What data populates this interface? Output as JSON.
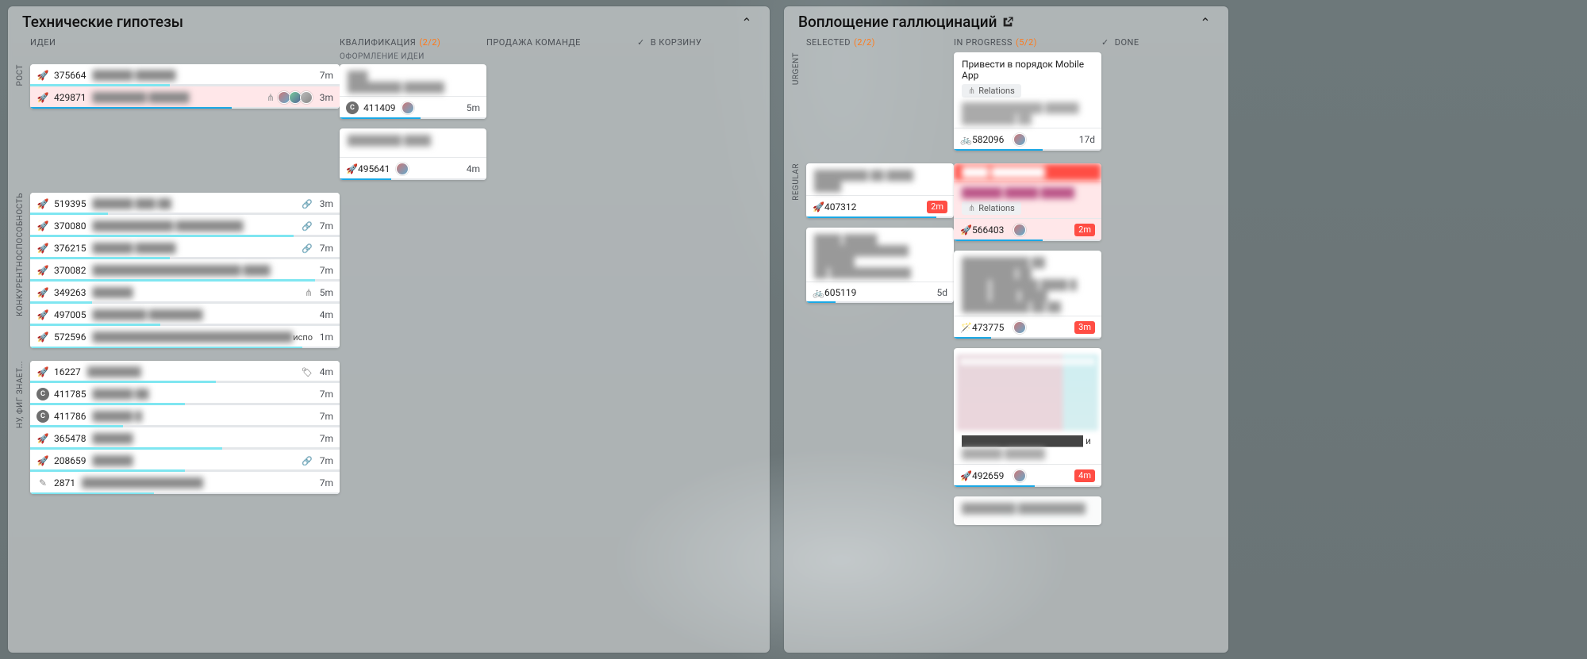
{
  "boards": {
    "left": {
      "title": "Технические гипотезы",
      "columns": {
        "c1": "ИДЕИ",
        "c2": "КВАЛИФИКАЦИЯ",
        "c2_ratio": "(2/2)",
        "c2_sub": "ОФОРМЛЕНИЕ ИДЕИ",
        "c3": "ПРОДАЖА КОМАНДЕ",
        "c4": "В КОРЗИНУ"
      },
      "lanes": {
        "rost": "РОСТ",
        "konk": "КОНКУРЕНТНОСПОСОБНОСТЬ",
        "nu": "НУ, ФИГ ЗНАЕТ..."
      },
      "rost_rows": [
        {
          "icon": "rocket",
          "id": "375664",
          "age": "7m",
          "pink": false,
          "progress": 45
        },
        {
          "icon": "rocket",
          "id": "429871",
          "age": "3m",
          "pink": true,
          "avatars": 3,
          "tree": true,
          "progress": 65
        }
      ],
      "rost_qual": [
        {
          "header_blur": true,
          "footer": {
            "id": "411409",
            "age": "5m",
            "avatar": true,
            "circle": "C"
          }
        },
        {
          "header_blur": true,
          "footer": {
            "id": "495641",
            "age": "4m",
            "avatar": true,
            "icon": "rocket"
          }
        }
      ],
      "konk_rows": [
        {
          "icon": "rocket",
          "id": "519395",
          "age": "3m",
          "link": true,
          "progress": 25
        },
        {
          "icon": "rocket",
          "id": "370080",
          "age": "7m",
          "link": true,
          "progress": 85
        },
        {
          "icon": "rocket",
          "id": "376215",
          "age": "7m",
          "link": true,
          "progress": 45
        },
        {
          "icon": "rocket",
          "id": "370082",
          "age": "7m",
          "progress": 92
        },
        {
          "icon": "rocket",
          "id": "349263",
          "age": "5m",
          "tree": true,
          "progress": 20
        },
        {
          "icon": "rocket",
          "id": "497005",
          "age": "4m",
          "progress": 42
        },
        {
          "icon": "rocket",
          "id": "572596",
          "age": "1m",
          "note": "испо",
          "progress": 88
        }
      ],
      "nu_rows": [
        {
          "icon": "rocket",
          "id": "16227",
          "age": "4m",
          "tag": true,
          "progress": 60
        },
        {
          "circle": "C",
          "id": "411785",
          "age": "7m",
          "progress": 50
        },
        {
          "circle": "C",
          "id": "411786",
          "age": "7m",
          "progress": 30
        },
        {
          "icon": "rocket",
          "id": "365478",
          "age": "7m",
          "progress": 62
        },
        {
          "icon": "rocket",
          "id": "208659",
          "age": "7m",
          "link": true,
          "progress": 50
        },
        {
          "icon": "pencil",
          "id": "2871",
          "age": "7m",
          "progress": 40
        }
      ]
    },
    "right": {
      "title": "Воплощение галлюцинаций",
      "columns": {
        "c1": "SELECTED",
        "c1_ratio": "(2/2)",
        "c2": "IN PROGRESS",
        "c2_ratio": "(5/2)",
        "c3": "DONE"
      },
      "lanes": {
        "urgent": "URGENT",
        "regular": "REGULAR"
      },
      "chip_relations": "Relations",
      "urgent_inprogress": {
        "title": "Привести в порядок Mobile App",
        "footer": {
          "icon": "bike",
          "id": "582096",
          "avatar": true,
          "age": "17d",
          "progress": 60
        }
      },
      "regular_selected": [
        {
          "footer": {
            "icon": "rocket",
            "id": "407312",
            "age": "2m",
            "badge": true,
            "progress": 88
          }
        },
        {
          "footer": {
            "icon": "bike",
            "id": "605119",
            "age": "5d",
            "progress": 20
          }
        }
      ],
      "regular_inprogress": [
        {
          "redhead": true,
          "relations": true,
          "footer": {
            "icon": "rocket",
            "id": "566403",
            "avatar": true,
            "age": "2m",
            "badge": true,
            "progress": 60
          }
        },
        {
          "footer": {
            "icon": "wand",
            "id": "473775",
            "avatar": true,
            "age": "3m",
            "badge": true,
            "progress": 25
          }
        },
        {
          "thumb": true,
          "footer": {
            "icon": "rocket",
            "id": "492659",
            "avatar": true,
            "age": "4m",
            "badge": true,
            "progress": 55
          }
        },
        {
          "footer": {
            "icon": "rocket",
            "id": "",
            "age": "",
            "progress": 10
          }
        }
      ]
    }
  }
}
